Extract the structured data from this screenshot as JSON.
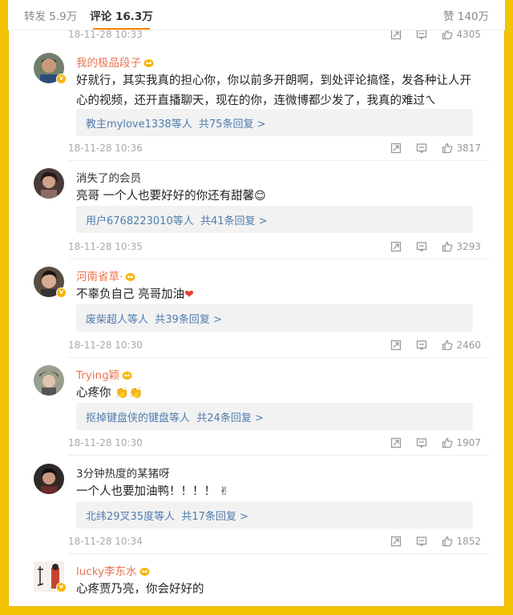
{
  "tabs": {
    "repost": "转发 5.9万",
    "comment": "评论 16.3万",
    "like": "赞 140万"
  },
  "top_meta": {
    "time": "18-11-28 10:33",
    "likes": "4305"
  },
  "comments": [
    {
      "name": "我的极品段子",
      "member": true,
      "text": "好就行，其实我真的担心你，你以前多开朗啊，到处评论搞怪，发各种让人开心的视频，还开直播聊天，现在的你，连微博都少发了，我真的难过",
      "emoji": "ㄟ",
      "reply_users": "教主mylove1338等人",
      "reply_count": "共75条回复 >",
      "time": "18-11-28 10:36",
      "likes": "3817"
    },
    {
      "name": "消失了的会员",
      "member": false,
      "text": "亮哥 一个人也要好好的你还有甜馨",
      "emoji": "😊",
      "reply_users": "用户6768223010等人",
      "reply_count": "共41条回复 >",
      "time": "18-11-28 10:35",
      "likes": "3293"
    },
    {
      "name": "河南省草·",
      "member": true,
      "text": "不辜负自己 亮哥加油",
      "emoji": "❤",
      "reply_users": "废柴超人等人",
      "reply_count": "共39条回复 >",
      "time": "18-11-28 10:30",
      "likes": "2460"
    },
    {
      "name": "Trying颖",
      "member": true,
      "text": "心疼你",
      "emoji": "👏👏",
      "reply_users": "抠掉键盘侠的键盘等人",
      "reply_count": "共24条回复 >",
      "time": "18-11-28 10:30",
      "likes": "1907"
    },
    {
      "name": "3分钟热度的某猪呀",
      "member": false,
      "text": "一个人也要加油鸭！！！！",
      "emoji": "✌",
      "reply_users": "北纬29叉35度等人",
      "reply_count": "共17条回复 >",
      "time": "18-11-28 10:34",
      "likes": "1852"
    },
    {
      "name": "lucky李东水",
      "member": true,
      "text": "心疼贾乃亮，你会好好的",
      "emoji": "",
      "reply_users": "",
      "reply_count": "",
      "time": "",
      "likes": ""
    }
  ],
  "colors": {
    "background": "#f5c400",
    "member_name": "#eb7350",
    "reply_link": "#507daf",
    "active_tab_underline": "#ff8200"
  },
  "icons": [
    "repost-icon",
    "comment-icon",
    "like-icon",
    "vip-crown-icon",
    "verified-badge-icon"
  ]
}
